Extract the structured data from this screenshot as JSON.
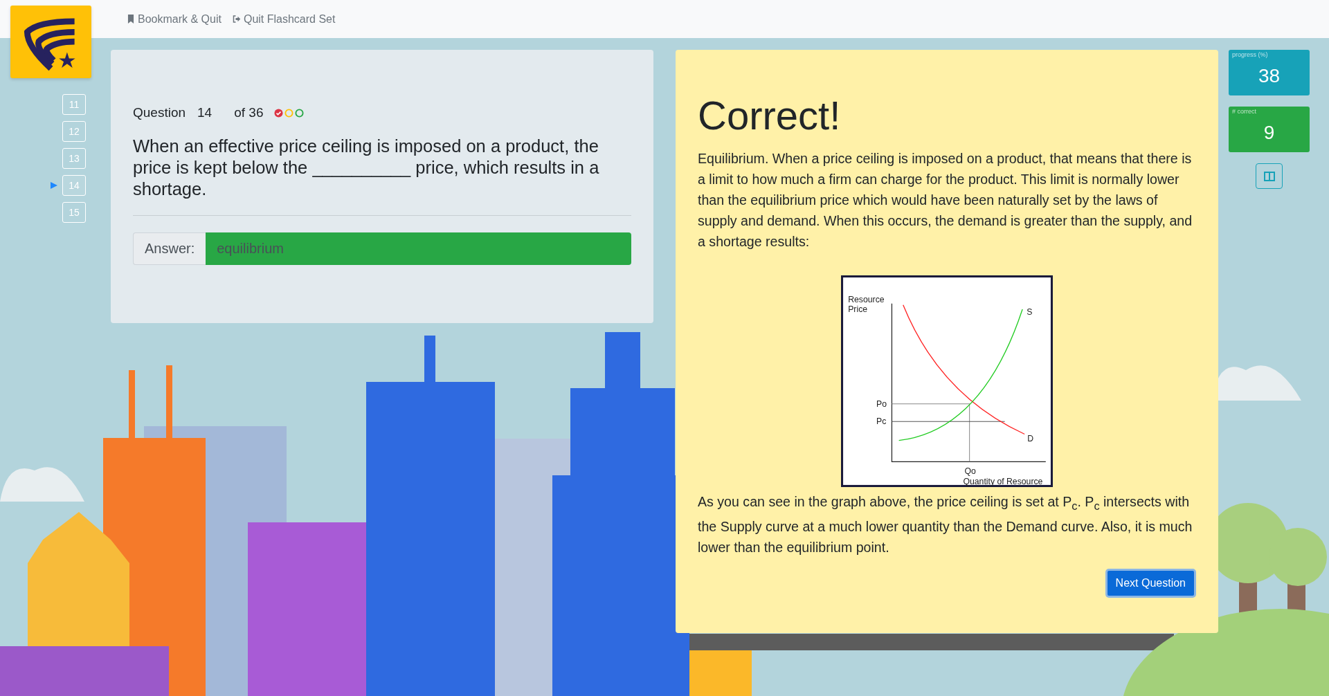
{
  "top_nav": [
    {
      "kind": "bookmark",
      "label": "Bookmark & Quit"
    },
    {
      "kind": "exit",
      "label": "Quit Flashcard Set"
    }
  ],
  "question_nav": [
    {
      "label": "11",
      "selected": false
    },
    {
      "label": "12",
      "selected": false
    },
    {
      "label": "13",
      "selected": false
    },
    {
      "label": "14",
      "selected": true
    },
    {
      "label": "15",
      "selected": false
    }
  ],
  "question": {
    "label": "Question",
    "number": "14",
    "total": "of 36",
    "status_marks": [
      {
        "kind": "check",
        "color": "#dc3545"
      },
      {
        "kind": "ring",
        "color": "#ffc107"
      },
      {
        "kind": "ring",
        "color": "#28a745"
      }
    ],
    "text": "When an effective price ceiling is imposed on a product, the price is kept below the __________ price, which results in a shortage.",
    "answer_label": "Answer:",
    "answer_value": "equilibrium",
    "correct": true
  },
  "feedback": {
    "title": "Correct!",
    "paragraph_1": "Equilibrium. When a price ceiling is imposed on a product, that means that there is a limit to how much a firm can charge for the product. This limit is normally lower than the equilibrium price which would have been naturally set by the laws of supply and demand. When this occurs, the demand is greater than the supply, and a shortage results:",
    "figure": {
      "y_axis_label": "Resource Price",
      "x_axis_label": "Quantity of Resource",
      "supply_label": "S",
      "demand_label": "D",
      "equilibrium_price_label": "Po",
      "ceiling_price_label": "Pc",
      "equilibrium_quantity_label": "Qo"
    },
    "paragraph_2": "As you can see in the graph above, the price ceiling is set at P$_{c}$. P$_{c}$ intersects with the Supply curve at a much lower quantity than the Demand curve. Also, it is much lower than the equilibrium point.",
    "next_button": "Next Question"
  },
  "stats": [
    {
      "kind": "progress",
      "label": "progress (%)",
      "value": "38"
    },
    {
      "kind": "correct",
      "label": "# correct",
      "value": "9"
    }
  ]
}
